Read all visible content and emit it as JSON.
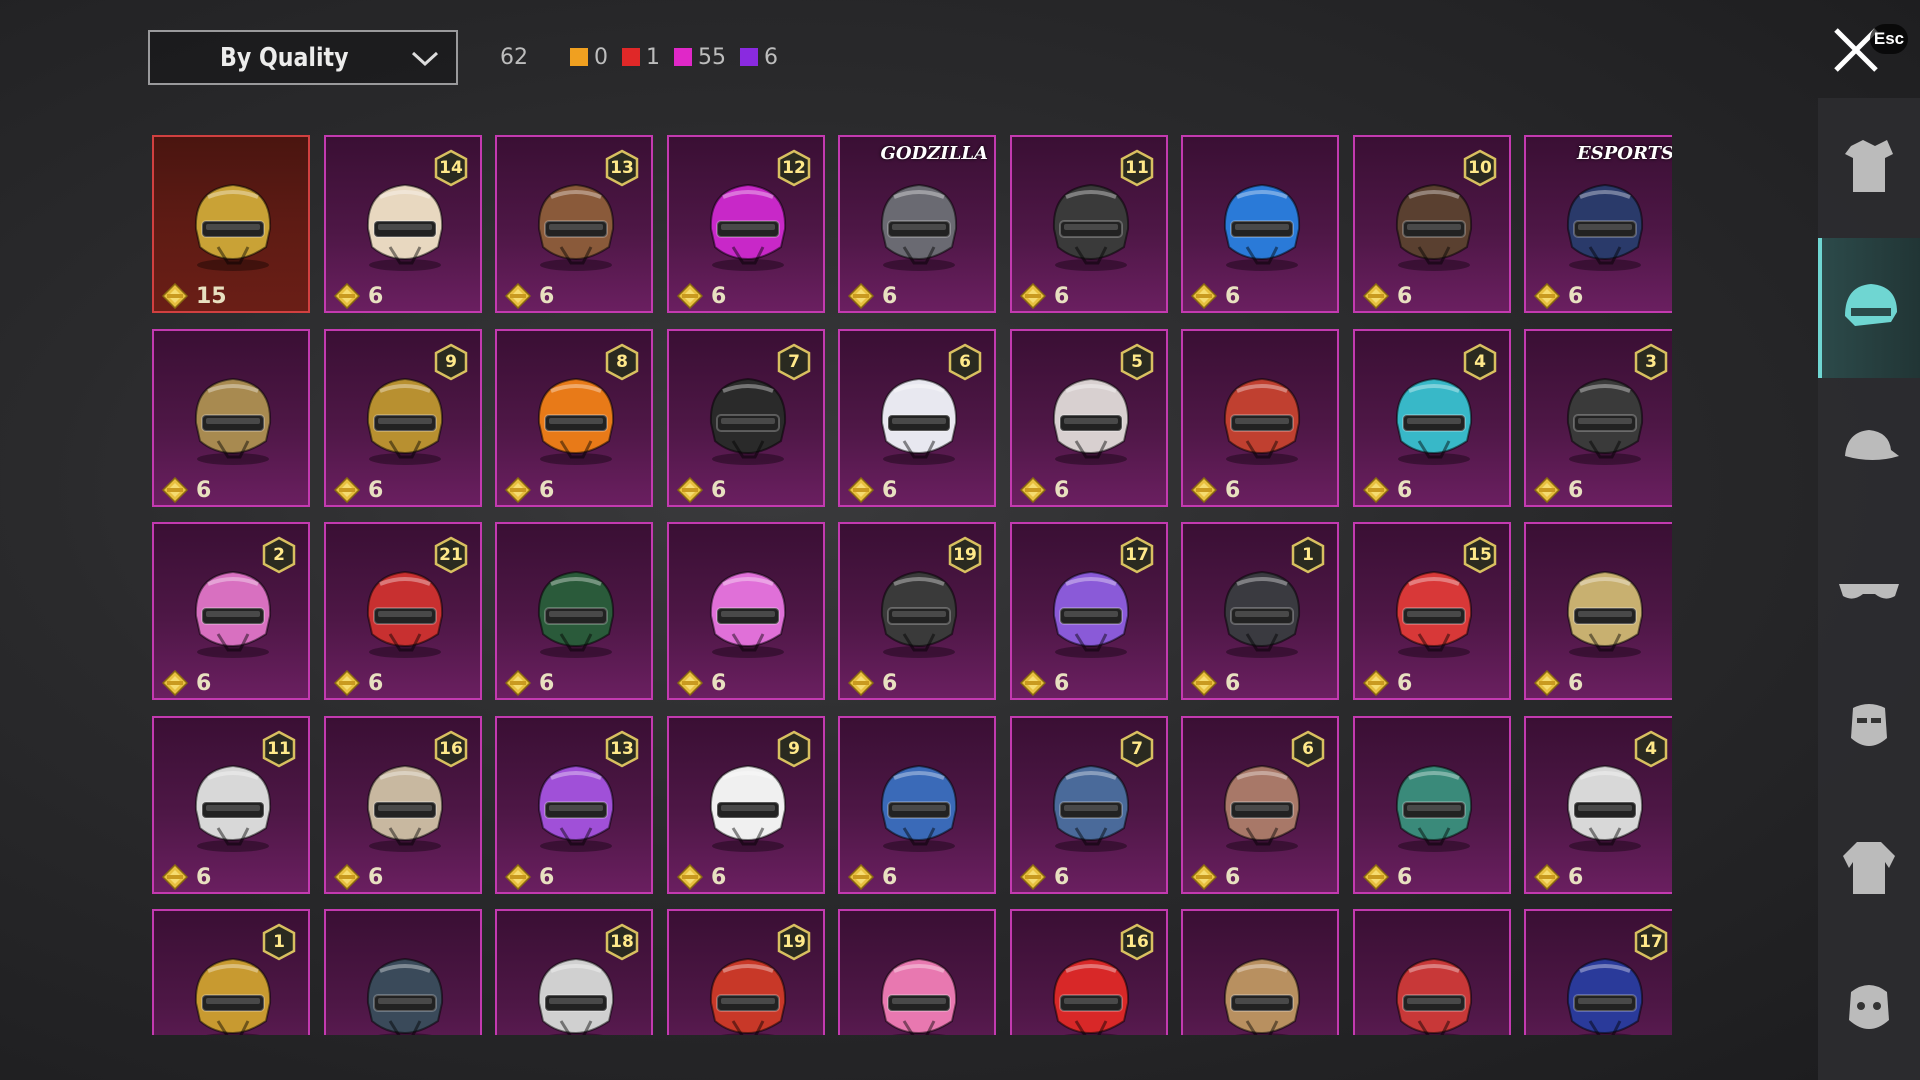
{
  "header": {
    "sort_label": "By Quality",
    "total_count": "62",
    "quality_counts": [
      {
        "color": "#f0a020",
        "count": "0"
      },
      {
        "color": "#e02828",
        "count": "1"
      },
      {
        "color": "#e028c8",
        "count": "55"
      },
      {
        "color": "#8a2ae0",
        "count": "6"
      }
    ],
    "esc_label": "Esc"
  },
  "items": [
    {
      "price": "15",
      "badge": "",
      "tag": "",
      "quality": "legendary",
      "color": "#c9a236"
    },
    {
      "price": "6",
      "badge": "14",
      "tag": "",
      "quality": "epic",
      "color": "#e8d8c0"
    },
    {
      "price": "6",
      "badge": "13",
      "tag": "",
      "quality": "epic",
      "color": "#8a5a3a"
    },
    {
      "price": "6",
      "badge": "12",
      "tag": "",
      "quality": "epic",
      "color": "#c828c8"
    },
    {
      "price": "6",
      "badge": "",
      "tag": "GODZILLA",
      "quality": "epic",
      "color": "#6a6a72"
    },
    {
      "price": "6",
      "badge": "11",
      "tag": "",
      "quality": "epic",
      "color": "#3a3a3a"
    },
    {
      "price": "6",
      "badge": "",
      "tag": "",
      "quality": "epic",
      "color": "#2a7ad8"
    },
    {
      "price": "6",
      "badge": "10",
      "tag": "",
      "quality": "epic",
      "color": "#5a4030"
    },
    {
      "price": "6",
      "badge": "",
      "tag": "ESPORTS",
      "quality": "epic",
      "color": "#2a3a6a"
    },
    {
      "price": "6",
      "badge": "",
      "tag": "",
      "quality": "epic",
      "color": "#a88a50"
    },
    {
      "price": "6",
      "badge": "9",
      "tag": "",
      "quality": "epic",
      "color": "#b89030"
    },
    {
      "price": "6",
      "badge": "8",
      "tag": "",
      "quality": "epic",
      "color": "#e87a18"
    },
    {
      "price": "6",
      "badge": "7",
      "tag": "",
      "quality": "epic",
      "color": "#2a2a2a"
    },
    {
      "price": "6",
      "badge": "6",
      "tag": "",
      "quality": "epic",
      "color": "#e8e8f0"
    },
    {
      "price": "6",
      "badge": "5",
      "tag": "",
      "quality": "epic",
      "color": "#d8d0d0"
    },
    {
      "price": "6",
      "badge": "",
      "tag": "",
      "quality": "epic",
      "color": "#c04030"
    },
    {
      "price": "6",
      "badge": "4",
      "tag": "",
      "quality": "epic",
      "color": "#38b8c8"
    },
    {
      "price": "6",
      "badge": "3",
      "tag": "",
      "quality": "epic",
      "color": "#3a3a3a"
    },
    {
      "price": "6",
      "badge": "2",
      "tag": "",
      "quality": "epic",
      "color": "#d870c0"
    },
    {
      "price": "6",
      "badge": "21",
      "tag": "",
      "quality": "epic",
      "color": "#c83030"
    },
    {
      "price": "6",
      "badge": "",
      "tag": "",
      "quality": "epic",
      "color": "#2a5a3a"
    },
    {
      "price": "6",
      "badge": "",
      "tag": "",
      "quality": "epic",
      "color": "#e070d8"
    },
    {
      "price": "6",
      "badge": "19",
      "tag": "",
      "quality": "epic",
      "color": "#3a3a3a"
    },
    {
      "price": "6",
      "badge": "17",
      "tag": "",
      "quality": "epic",
      "color": "#8a5ad8"
    },
    {
      "price": "6",
      "badge": "1",
      "tag": "",
      "quality": "epic",
      "color": "#3a3a40"
    },
    {
      "price": "6",
      "badge": "15",
      "tag": "",
      "quality": "epic",
      "color": "#d83838"
    },
    {
      "price": "6",
      "badge": "",
      "tag": "",
      "quality": "epic",
      "color": "#c8b070"
    },
    {
      "price": "6",
      "badge": "11",
      "tag": "",
      "quality": "epic",
      "color": "#d8d8d8"
    },
    {
      "price": "6",
      "badge": "16",
      "tag": "",
      "quality": "epic",
      "color": "#c8b8a0"
    },
    {
      "price": "6",
      "badge": "13",
      "tag": "",
      "quality": "epic",
      "color": "#a050d8"
    },
    {
      "price": "6",
      "badge": "9",
      "tag": "",
      "quality": "epic",
      "color": "#f0f0f0"
    },
    {
      "price": "6",
      "badge": "",
      "tag": "",
      "quality": "epic",
      "color": "#3a6ab8"
    },
    {
      "price": "6",
      "badge": "7",
      "tag": "",
      "quality": "epic",
      "color": "#4a6a9a"
    },
    {
      "price": "6",
      "badge": "6",
      "tag": "",
      "quality": "epic",
      "color": "#a87868"
    },
    {
      "price": "6",
      "badge": "",
      "tag": "",
      "quality": "epic",
      "color": "#3a8a7a"
    },
    {
      "price": "6",
      "badge": "4",
      "tag": "",
      "quality": "epic",
      "color": "#d8d8d8"
    },
    {
      "price": "",
      "badge": "1",
      "tag": "",
      "quality": "epic",
      "color": "#c89a30"
    },
    {
      "price": "",
      "badge": "",
      "tag": "",
      "quality": "epic",
      "color": "#3a4a5a"
    },
    {
      "price": "",
      "badge": "18",
      "tag": "",
      "quality": "epic",
      "color": "#d0d0d0"
    },
    {
      "price": "",
      "badge": "19",
      "tag": "",
      "quality": "epic",
      "color": "#c83828"
    },
    {
      "price": "",
      "badge": "",
      "tag": "",
      "quality": "epic",
      "color": "#e878b0"
    },
    {
      "price": "",
      "badge": "16",
      "tag": "",
      "quality": "epic",
      "color": "#d82828"
    },
    {
      "price": "",
      "badge": "",
      "tag": "",
      "quality": "epic",
      "color": "#b89060"
    },
    {
      "price": "",
      "badge": "",
      "tag": "",
      "quality": "epic",
      "color": "#c83838"
    },
    {
      "price": "",
      "badge": "17",
      "tag": "",
      "quality": "epic",
      "color": "#2a3a9a"
    }
  ],
  "sidebar": [
    {
      "icon": "outfit-icon",
      "active": false
    },
    {
      "icon": "helmet-icon",
      "active": true
    },
    {
      "icon": "hat-icon",
      "active": false
    },
    {
      "icon": "glasses-icon",
      "active": false
    },
    {
      "icon": "mask-icon",
      "active": false
    },
    {
      "icon": "jacket-icon",
      "active": false
    },
    {
      "icon": "face-icon",
      "active": false
    }
  ]
}
